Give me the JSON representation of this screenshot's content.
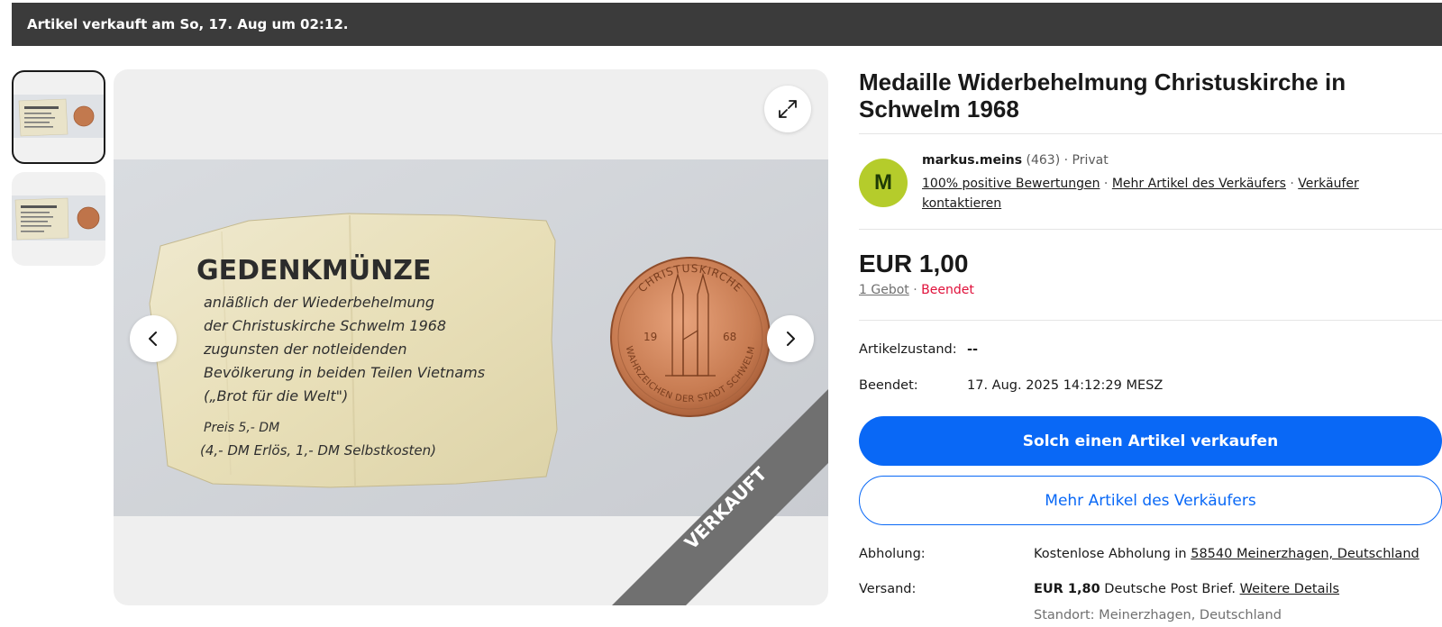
{
  "banner": {
    "text": "Artikel verkauft am So, 17. Aug um 02:12."
  },
  "gallery": {
    "ribbon_text": "VERKAUFT",
    "photo_text": {
      "heading": "GEDENKMÜNZE",
      "lines": [
        "anläßlich der Wiederbehelmung",
        "der Christuskirche Schwelm 1968",
        "zugunsten der notleidenden",
        "Bevölkerung in beiden Teilen Vietnams",
        "(„Brot für die Welt\")",
        "Preis 5,- DM",
        "(4,- DM Erlös, 1,- DM Selbstkosten)"
      ]
    },
    "coin_text": {
      "top": "CHRISTUSKIRCHE",
      "bottom": "WAHRZEICHEN DER STADT SCHWELM",
      "year_left": "19",
      "year_right": "68"
    }
  },
  "listing": {
    "title": "Medaille Widerbehelmung Christuskirche in Schwelm 1968"
  },
  "seller": {
    "avatar_letter": "M",
    "name": "markus.meins",
    "rating_count": "(463)",
    "sep": " · ",
    "type": "Privat",
    "feedback_link": "100% positive Bewertungen",
    "more_items_link": "Mehr Artikel des Verkäufers",
    "contact_link": "Verkäufer kontaktieren"
  },
  "price": {
    "amount": "EUR 1,00",
    "bids": "1 Gebot",
    "sep": " · ",
    "status": "Beendet"
  },
  "specs": {
    "condition_label": "Artikelzustand:",
    "condition_value": "--",
    "ended_label": "Beendet:",
    "ended_value": "17. Aug. 2025 14:12:29 MESZ"
  },
  "actions": {
    "sell_similar": "Solch einen Artikel verkaufen",
    "more_items": "Mehr Artikel des Verkäufers"
  },
  "shipping": {
    "pickup_label": "Abholung:",
    "pickup_text": "Kostenlose Abholung in",
    "pickup_link": "58540 Meinerzhagen, Deutschland",
    "shipping_label": "Versand:",
    "shipping_price": "EUR 1,80",
    "shipping_method": "Deutsche Post Brief.",
    "shipping_details": "Weitere Details",
    "location": "Standort: Meinerzhagen, Deutschland"
  },
  "colors": {
    "accent": "#0968f6",
    "ended": "#e0103a",
    "banner": "#3b3b3b",
    "avatar": "#b5cc2b"
  },
  "icons": {
    "expand": "expand-icon",
    "prev": "chevron-left-icon",
    "next": "chevron-right-icon"
  }
}
